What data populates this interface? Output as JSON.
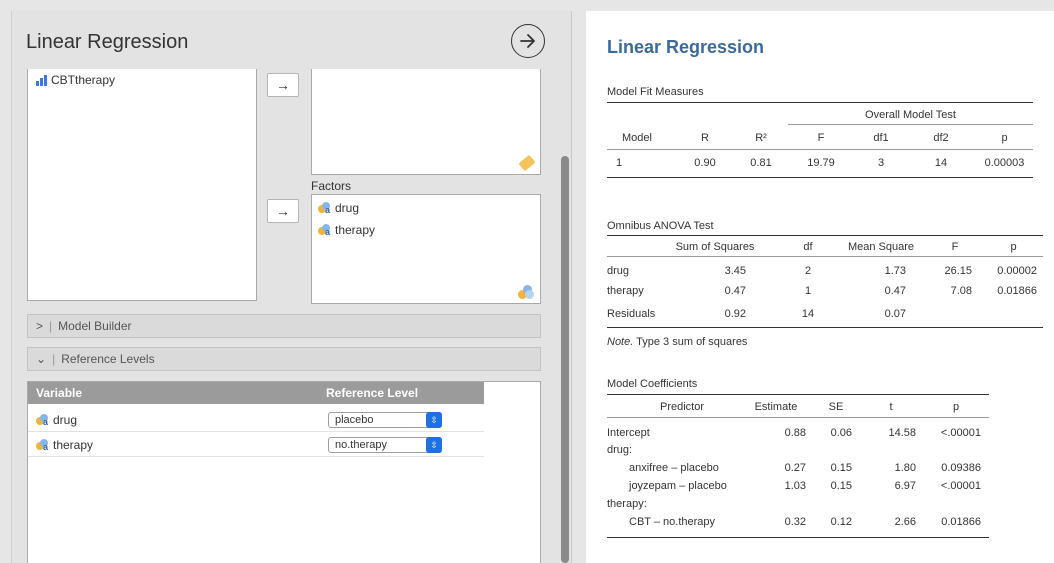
{
  "left_panel": {
    "title": "Linear Regression",
    "variables": [
      {
        "name": "CBTtherapy",
        "icon": "continuous-variable-icon"
      }
    ],
    "factors_label": "Factors",
    "factors": [
      {
        "name": "drug",
        "icon": "nominal-variable-icon"
      },
      {
        "name": "therapy",
        "icon": "nominal-variable-icon"
      }
    ],
    "arrow_glyph": "→",
    "model_builder": {
      "label": "Model Builder",
      "chevron": ">"
    },
    "reference_levels": {
      "label": "Reference Levels",
      "chevron": "⌄",
      "header": {
        "variable": "Variable",
        "level": "Reference Level"
      },
      "rows": [
        {
          "variable": "drug",
          "level": "placebo"
        },
        {
          "variable": "therapy",
          "level": "no.therapy"
        }
      ]
    }
  },
  "results": {
    "title": "Linear Regression",
    "model_fit": {
      "caption": "Model Fit Measures",
      "group_header": "Overall Model Test",
      "columns": [
        "Model",
        "R",
        "R²",
        "F",
        "df1",
        "df2",
        "p"
      ],
      "rows": [
        [
          "1",
          "0.90",
          "0.81",
          "19.79",
          "3",
          "14",
          "0.00003"
        ]
      ]
    },
    "anova": {
      "caption": "Omnibus ANOVA Test",
      "columns": [
        "",
        "Sum of Squares",
        "df",
        "Mean Square",
        "F",
        "p"
      ],
      "rows": [
        [
          "drug",
          "3.45",
          "2",
          "1.73",
          "26.15",
          "0.00002"
        ],
        [
          "therapy",
          "0.47",
          "1",
          "0.47",
          "7.08",
          "0.01866"
        ],
        [
          "Residuals",
          "0.92",
          "14",
          "0.07",
          "",
          ""
        ]
      ],
      "note_label": "Note.",
      "note_text": " Type 3 sum of squares"
    },
    "coefficients": {
      "caption": "Model Coefficients",
      "columns": [
        "Predictor",
        "Estimate",
        "SE",
        "t",
        "p"
      ],
      "rows": [
        [
          "Intercept",
          "0.88",
          "0.06",
          "14.58",
          "<.00001"
        ],
        [
          "drug:",
          "",
          "",
          "",
          ""
        ],
        [
          "anxifree – placebo",
          "0.27",
          "0.15",
          "1.80",
          "0.09386"
        ],
        [
          "joyzepam – placebo",
          "1.03",
          "0.15",
          "6.97",
          "<.00001"
        ],
        [
          "therapy:",
          "",
          "",
          "",
          ""
        ],
        [
          "CBT – no.therapy",
          "0.32",
          "0.12",
          "2.66",
          "0.01866"
        ]
      ]
    }
  }
}
